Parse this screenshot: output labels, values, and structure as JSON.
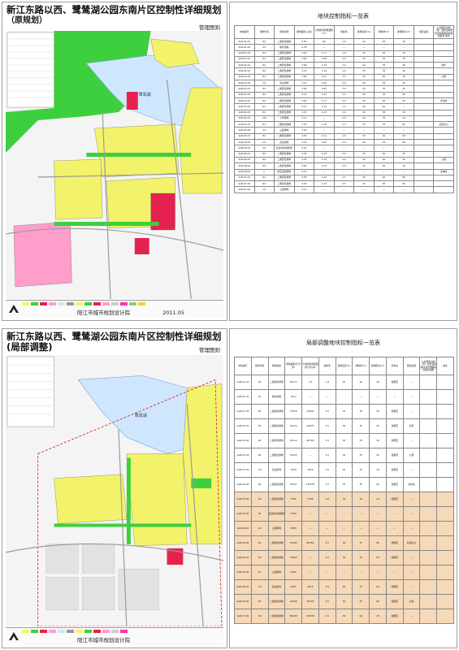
{
  "top": {
    "map_title": "新江东路以西、鹭鸶湖公园东南片区控制性详细规划",
    "map_subtitle": "（原规划）",
    "map_mgmt": "管理图则",
    "map_institute": "阳江市城市规划设计院",
    "map_date": "2011.05",
    "map_lake_label": "鹭鸶湖",
    "table_title": "地块控制指标一览表",
    "headers": [
      "地块编号",
      "用地代码",
      "用地性质",
      "用地面积(公顷)",
      "计容积率建筑面积(m²)",
      "容积率",
      "建筑密度(%)",
      "绿地率(%)",
      "建筑限高(m)",
      "配套设施",
      "公共配套设施（含）配套设施规划须有明确供性规划面积 类别"
    ],
    "rows": [
      [
        "GLB-01-01",
        "R2",
        "二类居住用地",
        "4.61",
        "84",
        "1.9",
        "20",
        "40",
        "30",
        "",
        ""
      ],
      [
        "GLB-01-02",
        "S3",
        "城市道路",
        "0.76",
        "—",
        "—",
        "—",
        "—",
        "—",
        "",
        ""
      ],
      [
        "GLB-01-03",
        "R2",
        "二类居住用地",
        "2.18",
        "1.17",
        "1.8",
        "20",
        "40",
        "30",
        "",
        ""
      ],
      [
        "GLB-01-04",
        "R2",
        "二类居住用地",
        "2.60",
        "1.99",
        "2.0",
        "20",
        "35",
        "30",
        "",
        ""
      ],
      [
        "GLB-02-01",
        "R2",
        "二类居住用地",
        "3.96",
        "1.22",
        "2.0",
        "20",
        "35",
        "30",
        "",
        "幼托"
      ],
      [
        "GLB-02-02",
        "R2",
        "二类居住用地",
        "3.23",
        "1.18",
        "1.6",
        "25",
        "35",
        "40",
        "",
        ""
      ],
      [
        "GLB-02-03",
        "R2",
        "二类居住用地",
        "3.92",
        "1.21",
        "3.1",
        "30",
        "40",
        "45",
        "",
        "公厕"
      ],
      [
        "GLB-02-04",
        "C2",
        "商业用地",
        "1.11",
        "1.00",
        "2.0",
        "40",
        "30",
        "45",
        "",
        ""
      ],
      [
        "GLB-03-01",
        "R2",
        "二类居住用地",
        "3.94",
        "3.02",
        "3.0",
        "30",
        "35",
        "45",
        "",
        ""
      ],
      [
        "GLB-03-02",
        "R2",
        "二类居住用地",
        "2.12",
        "1.34",
        "2.2",
        "30",
        "35",
        "45",
        "",
        ""
      ],
      [
        "GLB-03-03",
        "R2",
        "二类居住用地",
        "3.61",
        "1.17",
        "2.2",
        "25",
        "30",
        "60",
        "",
        "文化站"
      ],
      [
        "GLB-03-04",
        "R2",
        "二类居住用地",
        "5.13",
        "1.35",
        "1.5",
        "30",
        "40",
        "—",
        "",
        ""
      ],
      [
        "GLB-04-01",
        "R2",
        "二类居住用地",
        "1.97",
        "1.12",
        "1.0",
        "30",
        "35",
        "30",
        "",
        ""
      ],
      [
        "GLB-04-02",
        "A33",
        "小学用地",
        "2.13",
        "—",
        "0.9",
        "20",
        "35",
        "24",
        "",
        ""
      ],
      [
        "GLB-04-03",
        "R2",
        "二类居住用地",
        "3.33",
        "1.20",
        "2.5",
        "25",
        "35",
        "60",
        "",
        "社区中心"
      ],
      [
        "GLB-04-04",
        "G1",
        "公园绿地",
        "1.01",
        "—",
        "—",
        "—",
        "—",
        "—",
        "",
        ""
      ],
      [
        "GLB-05-01",
        "R2",
        "二类居住用地",
        "4.53",
        "1.21",
        "2.5",
        "30",
        "40",
        "60",
        "",
        ""
      ],
      [
        "GLB-05-02",
        "C2",
        "商业用地",
        "1.19",
        "1.00",
        "3.0",
        "40",
        "25",
        "60",
        "",
        ""
      ],
      [
        "GLB-05-03",
        "S4",
        "社会停车场用地",
        "0.35",
        "—",
        "—",
        "—",
        "—",
        "—",
        "",
        ""
      ],
      [
        "GLB-06-01",
        "R2",
        "二类居住用地",
        "3.25",
        "1.18",
        "2.0",
        "30",
        "40",
        "45",
        "",
        ""
      ],
      [
        "GLB-06-02",
        "R2",
        "二类居住用地",
        "3.35",
        "1.22",
        "2.0",
        "30",
        "40",
        "45",
        "",
        "公厕"
      ],
      [
        "GLB-06-03",
        "R2",
        "二类居住用地",
        "2.81",
        "1.33",
        "2.0",
        "30",
        "40",
        "45",
        "",
        ""
      ],
      [
        "GLB-06-04",
        "U",
        "供应设施用地",
        "0.31",
        "—",
        "—",
        "—",
        "—",
        "—",
        "",
        "变电站"
      ],
      [
        "GLB-07-01",
        "R2",
        "二类居住用地",
        "3.58",
        "1.24",
        "2.5",
        "30",
        "40",
        "60",
        "",
        ""
      ],
      [
        "GLB-07-02",
        "R2",
        "二类居住用地",
        "4.25",
        "1.15",
        "2.5",
        "30",
        "40",
        "60",
        "",
        ""
      ],
      [
        "GLB-07-03",
        "G1",
        "公园绿地",
        "2.11",
        "—",
        "—",
        "—",
        "—",
        "—",
        "",
        ""
      ]
    ]
  },
  "bottom": {
    "map_title": "新江东路以西、鹭鸶湖公园东南片区控制性详细规划(局部调整)",
    "map_mgmt": "管理图则",
    "map_institute": "阳江市城市规划设计院",
    "map_lake_label": "鹭鸶湖",
    "table_title": "局部调整地块控制指标一览表",
    "headers": [
      "地块编号",
      "用地代码",
      "用地性质",
      "用地面积(平方米)",
      "计容积率建筑面积(平方米)",
      "容积率",
      "建筑密度(%)",
      "绿地率(%)",
      "建筑限高(m)",
      "停车位",
      "配套设施",
      "公共配套设施（含）配套设施规划须有明确供性规划面积",
      "备注"
    ],
    "rows": [
      [
        "GLB-01-01",
        "R2",
        "二类居住用地",
        "46172",
        "70",
        "1.9",
        "20",
        "40",
        "30",
        "按规范",
        "—",
        "",
        ""
      ],
      [
        "GLB-01-02",
        "S3",
        "城市道路",
        "7617",
        "—",
        "—",
        "—",
        "—",
        "—",
        "—",
        "—",
        "",
        ""
      ],
      [
        "GLB-01-03",
        "R2",
        "二类居住用地",
        "17656",
        "44600",
        "2.5",
        "25",
        "35",
        "45",
        "按规范",
        "—",
        "",
        ""
      ],
      [
        "GLB-02-01",
        "R2",
        "二类居住用地",
        "22220",
        "44675",
        "2.5",
        "30",
        "35",
        "45",
        "按规范",
        "幼托",
        "",
        ""
      ],
      [
        "GLB-02-02",
        "R2",
        "二类居住用地",
        "20112",
        "80760",
        "2.5",
        "30",
        "35",
        "45",
        "按规范",
        "—",
        "",
        ""
      ],
      [
        "GLB-02-03",
        "R2",
        "二类居住用地",
        "23225",
        "—",
        "2.5",
        "30",
        "35",
        "45",
        "按规范",
        "公厕",
        "",
        ""
      ],
      [
        "GLB-03-01",
        "C2",
        "商业用地",
        "2529",
        "2529",
        "1.0",
        "40",
        "25",
        "24",
        "按规范",
        "—",
        "",
        ""
      ],
      [
        "GLB-03-02",
        "R2",
        "二类居住用地",
        "53221",
        "133078",
        "2.5",
        "25",
        "35",
        "60",
        "按规范",
        "文化站",
        "",
        ""
      ],
      [
        "GLB-03-03",
        "R2",
        "二类居住用地",
        "3766",
        "3766",
        "1.0",
        "30",
        "30",
        "24",
        "按规范",
        "—",
        "",
        ""
      ],
      [
        "GLB-03-04",
        "S4",
        "社会停车场用地",
        "2759",
        "—",
        "—",
        "—",
        "—",
        "—",
        "—",
        "—",
        "",
        ""
      ],
      [
        "GLB-04-01",
        "G1",
        "公园绿地",
        "4058",
        "—",
        "—",
        "—",
        "—",
        "—",
        "—",
        "—",
        "",
        ""
      ],
      [
        "GLB-04-02",
        "R2",
        "二类居住用地",
        "32180",
        "80450",
        "2.5",
        "30",
        "35",
        "60",
        "按规范",
        "社区中心",
        "",
        ""
      ],
      [
        "GLB-05-01",
        "R2",
        "二类居住用地",
        "31660",
        "—",
        "2.5",
        "30",
        "35",
        "60",
        "按规范",
        "—",
        "",
        ""
      ],
      [
        "GLB-05-02",
        "G1",
        "公园绿地",
        "2556",
        "—",
        "—",
        "—",
        "—",
        "—",
        "—",
        "—",
        "",
        ""
      ],
      [
        "GLB-06-01",
        "C2",
        "商业用地",
        "3005",
        "9015",
        "3.0",
        "40",
        "25",
        "60",
        "按规范",
        "—",
        "",
        ""
      ],
      [
        "GLB-06-02",
        "R2",
        "二类居住用地",
        "10066",
        "25165",
        "2.5",
        "30",
        "35",
        "60",
        "按规范",
        "公厕",
        "",
        ""
      ],
      [
        "GLB-07-01",
        "R2",
        "二类居住用地",
        "86160",
        "176552",
        "2.0",
        "30",
        "40",
        "45",
        "按规范",
        "—",
        "",
        ""
      ]
    ]
  },
  "colors": {
    "residential": "#f3f36b",
    "green": "#3ecf3e",
    "commercial": "#ff6e9a",
    "school": "#ff9ecb",
    "road": "#e6e6e6",
    "water": "#cfe6ff",
    "table_highlight": "#f5d9b8"
  }
}
